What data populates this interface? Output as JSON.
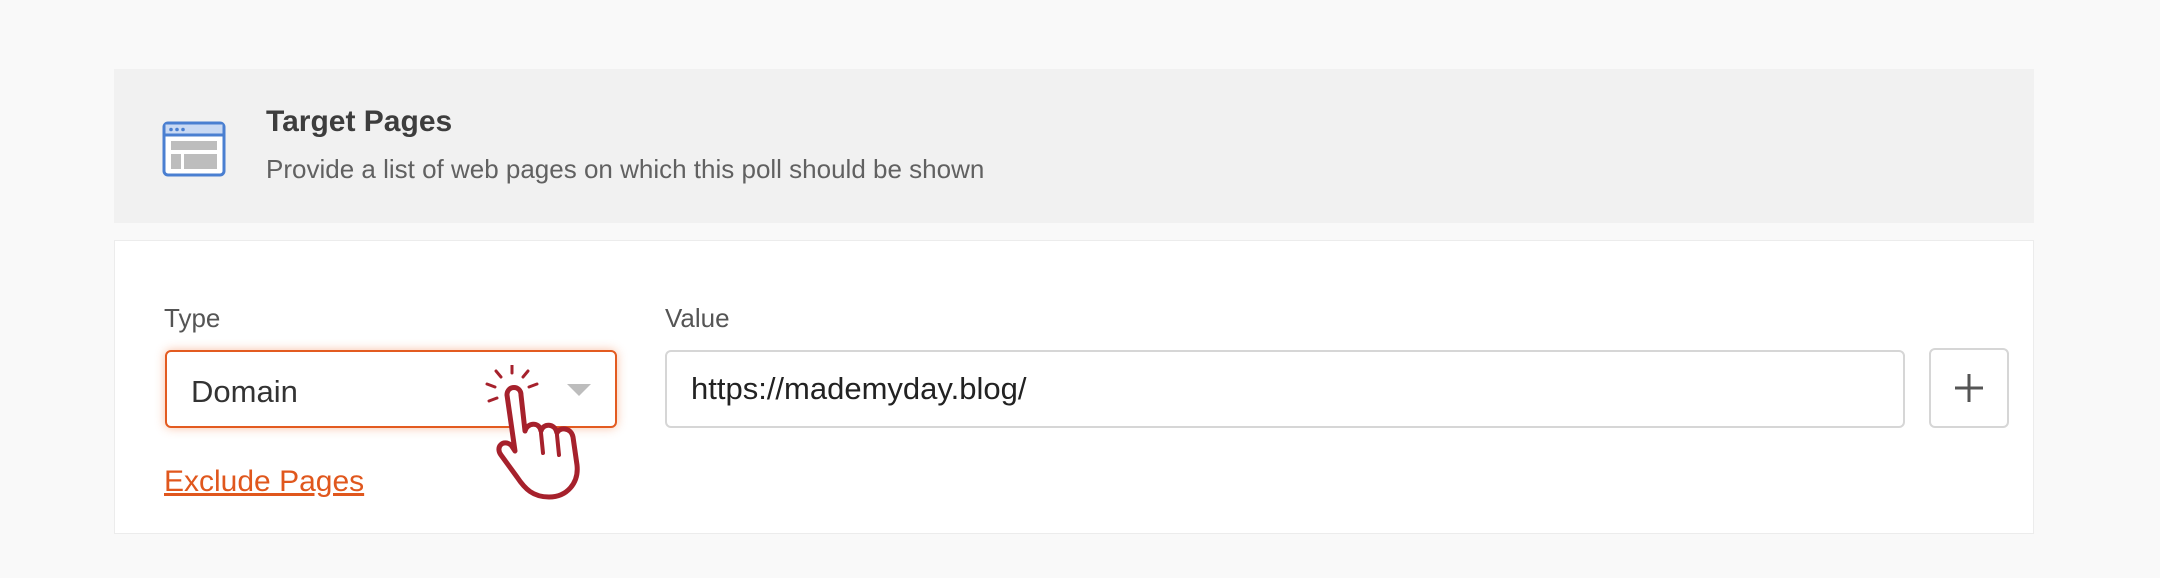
{
  "header": {
    "icon": "web-page-icon",
    "title": "Target Pages",
    "description": "Provide a list of web pages on which this poll should be shown"
  },
  "form": {
    "type_label": "Type",
    "type_selected": "Domain",
    "value_label": "Value",
    "value_input": "https://mademyday.blog/",
    "add_icon": "plus-icon",
    "exclude_link": "Exclude Pages"
  },
  "colors": {
    "accent": "#e0571d",
    "icon_blue": "#4a7fd1",
    "cursor": "#a6212c"
  },
  "cursor_icon": "pointing-hand-cursor-icon"
}
